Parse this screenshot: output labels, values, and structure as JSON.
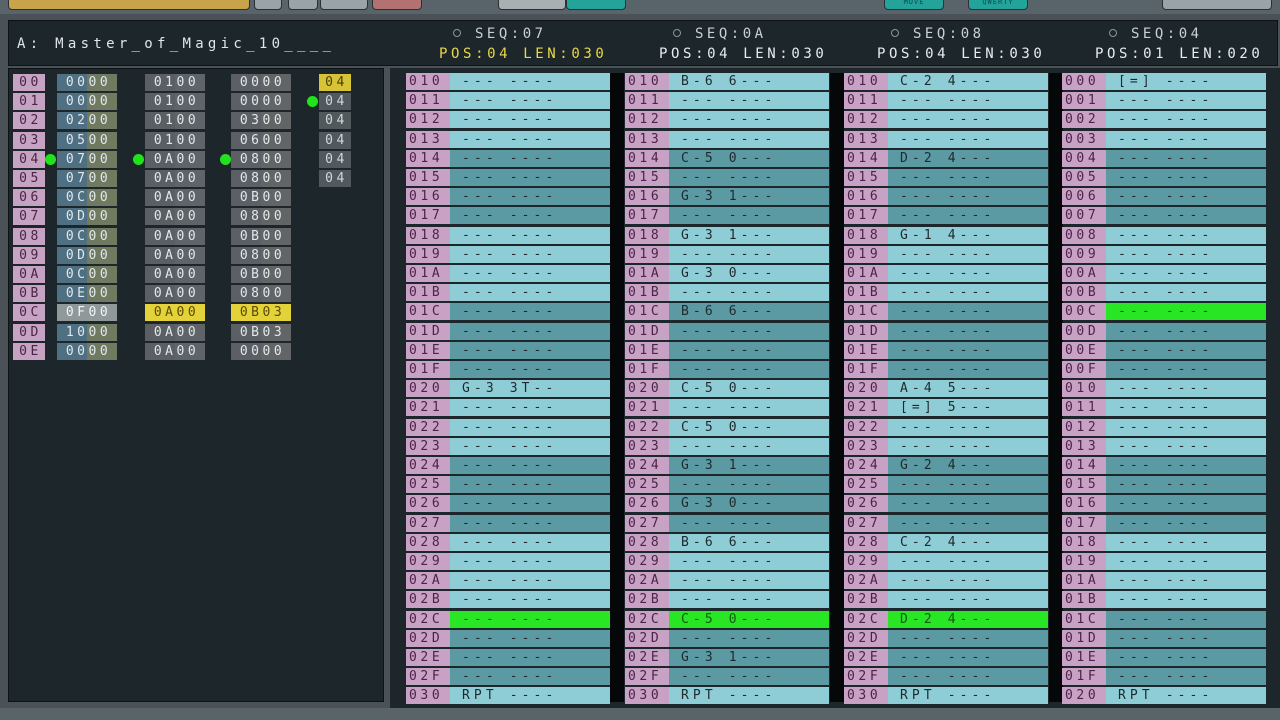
{
  "toolbar": {
    "buttons": [
      {
        "label": "",
        "color": "#c7a34a"
      },
      {
        "label": "",
        "color": "#9aa3a8"
      },
      {
        "label": "",
        "color": "#9aa3a8"
      },
      {
        "label": "",
        "color": "#9aa3a8"
      },
      {
        "label": "",
        "color": "#b27272"
      },
      {
        "label": "",
        "color": "#a8b0b4"
      },
      {
        "label": "",
        "color": "#24a39b"
      },
      {
        "label": "MOVE",
        "color": "#24a39b"
      },
      {
        "label": "QWERTY",
        "color": "#24a39b"
      },
      {
        "label": "",
        "color": "#9aa3a8"
      }
    ]
  },
  "header": {
    "title": "A: Master_of_Magic_10____",
    "sequences": [
      {
        "seq": "SEQ:07",
        "pos": "POS:04",
        "len": "LEN:030",
        "current": true
      },
      {
        "seq": "SEQ:0A",
        "pos": "POS:04",
        "len": "LEN:030",
        "current": false
      },
      {
        "seq": "SEQ:08",
        "pos": "POS:04",
        "len": "LEN:030",
        "current": false
      },
      {
        "seq": "SEQ:04",
        "pos": "POS:01",
        "len": "LEN:020",
        "current": false
      }
    ]
  },
  "orderlist": {
    "rows": [
      {
        "idx": "00",
        "t1": "0000",
        "t2": "0100",
        "t3": "0000",
        "t4": "04"
      },
      {
        "idx": "01",
        "t1": "0000",
        "t2": "0100",
        "t3": "0000",
        "t4": "04"
      },
      {
        "idx": "02",
        "t1": "0200",
        "t2": "0100",
        "t3": "0300",
        "t4": "04"
      },
      {
        "idx": "03",
        "t1": "0500",
        "t2": "0100",
        "t3": "0600",
        "t4": "04"
      },
      {
        "idx": "04",
        "t1": "0700",
        "t2": "0A00",
        "t3": "0800",
        "t4": "04"
      },
      {
        "idx": "05",
        "t1": "0700",
        "t2": "0A00",
        "t3": "0800",
        "t4": "04"
      },
      {
        "idx": "06",
        "t1": "0C00",
        "t2": "0A00",
        "t3": "0B00",
        "t4": ""
      },
      {
        "idx": "07",
        "t1": "0D00",
        "t2": "0A00",
        "t3": "0800",
        "t4": ""
      },
      {
        "idx": "08",
        "t1": "0C00",
        "t2": "0A00",
        "t3": "0B00",
        "t4": ""
      },
      {
        "idx": "09",
        "t1": "0D00",
        "t2": "0A00",
        "t3": "0800",
        "t4": ""
      },
      {
        "idx": "0A",
        "t1": "0C00",
        "t2": "0A00",
        "t3": "0B00",
        "t4": ""
      },
      {
        "idx": "0B",
        "t1": "0E00",
        "t2": "0A00",
        "t3": "0800",
        "t4": ""
      },
      {
        "idx": "0C",
        "t1": "0F00",
        "t2": "0A00",
        "t3": "0B03",
        "t4": ""
      },
      {
        "idx": "0D",
        "t1": "1000",
        "t2": "0A00",
        "t3": "0B03",
        "t4": ""
      },
      {
        "idx": "0E",
        "t1": "0000",
        "t2": "0A00",
        "t3": "0000",
        "t4": ""
      }
    ]
  },
  "pattern": {
    "columns": [
      {
        "rows": [
          [
            "010",
            "--- ----"
          ],
          [
            "011",
            "--- ----"
          ],
          [
            "012",
            "--- ----"
          ],
          [
            "013",
            "--- ----"
          ],
          [
            "014",
            "--- ----"
          ],
          [
            "015",
            "--- ----"
          ],
          [
            "016",
            "--- ----"
          ],
          [
            "017",
            "--- ----"
          ],
          [
            "018",
            "--- ----"
          ],
          [
            "019",
            "--- ----"
          ],
          [
            "01A",
            "--- ----"
          ],
          [
            "01B",
            "--- ----"
          ],
          [
            "01C",
            "--- ----"
          ],
          [
            "01D",
            "--- ----"
          ],
          [
            "01E",
            "--- ----"
          ],
          [
            "01F",
            "--- ----"
          ],
          [
            "020",
            "G-3 3T--"
          ],
          [
            "021",
            "--- ----"
          ],
          [
            "022",
            "--- ----"
          ],
          [
            "023",
            "--- ----"
          ],
          [
            "024",
            "--- ----"
          ],
          [
            "025",
            "--- ----"
          ],
          [
            "026",
            "--- ----"
          ],
          [
            "027",
            "--- ----"
          ],
          [
            "028",
            "--- ----"
          ],
          [
            "029",
            "--- ----"
          ],
          [
            "02A",
            "--- ----"
          ],
          [
            "02B",
            "--- ----"
          ],
          [
            "02C",
            "--- ----"
          ],
          [
            "02D",
            "--- ----"
          ],
          [
            "02E",
            "--- ----"
          ],
          [
            "02F",
            "--- ----"
          ],
          [
            "030",
            "RPT ----"
          ]
        ]
      },
      {
        "rows": [
          [
            "010",
            "B-6 6---"
          ],
          [
            "011",
            "--- ----"
          ],
          [
            "012",
            "--- ----"
          ],
          [
            "013",
            "--- ----"
          ],
          [
            "014",
            "C-5 0---"
          ],
          [
            "015",
            "--- ----"
          ],
          [
            "016",
            "G-3 1---"
          ],
          [
            "017",
            "--- ----"
          ],
          [
            "018",
            "G-3 1---"
          ],
          [
            "019",
            "--- ----"
          ],
          [
            "01A",
            "G-3 0---"
          ],
          [
            "01B",
            "--- ----"
          ],
          [
            "01C",
            "B-6 6---"
          ],
          [
            "01D",
            "--- ----"
          ],
          [
            "01E",
            "--- ----"
          ],
          [
            "01F",
            "--- ----"
          ],
          [
            "020",
            "C-5 0---"
          ],
          [
            "021",
            "--- ----"
          ],
          [
            "022",
            "C-5 0---"
          ],
          [
            "023",
            "--- ----"
          ],
          [
            "024",
            "G-3 1---"
          ],
          [
            "025",
            "--- ----"
          ],
          [
            "026",
            "G-3 0---"
          ],
          [
            "027",
            "--- ----"
          ],
          [
            "028",
            "B-6 6---"
          ],
          [
            "029",
            "--- ----"
          ],
          [
            "02A",
            "--- ----"
          ],
          [
            "02B",
            "--- ----"
          ],
          [
            "02C",
            "C-5 0---"
          ],
          [
            "02D",
            "--- ----"
          ],
          [
            "02E",
            "G-3 1---"
          ],
          [
            "02F",
            "--- ----"
          ],
          [
            "030",
            "RPT ----"
          ]
        ]
      },
      {
        "rows": [
          [
            "010",
            "C-2 4---"
          ],
          [
            "011",
            "--- ----"
          ],
          [
            "012",
            "--- ----"
          ],
          [
            "013",
            "--- ----"
          ],
          [
            "014",
            "D-2 4---"
          ],
          [
            "015",
            "--- ----"
          ],
          [
            "016",
            "--- ----"
          ],
          [
            "017",
            "--- ----"
          ],
          [
            "018",
            "G-1 4---"
          ],
          [
            "019",
            "--- ----"
          ],
          [
            "01A",
            "--- ----"
          ],
          [
            "01B",
            "--- ----"
          ],
          [
            "01C",
            "--- ----"
          ],
          [
            "01D",
            "--- ----"
          ],
          [
            "01E",
            "--- ----"
          ],
          [
            "01F",
            "--- ----"
          ],
          [
            "020",
            "A-4 5---"
          ],
          [
            "021",
            "[=] 5---"
          ],
          [
            "022",
            "--- ----"
          ],
          [
            "023",
            "--- ----"
          ],
          [
            "024",
            "G-2 4---"
          ],
          [
            "025",
            "--- ----"
          ],
          [
            "026",
            "--- ----"
          ],
          [
            "027",
            "--- ----"
          ],
          [
            "028",
            "C-2 4---"
          ],
          [
            "029",
            "--- ----"
          ],
          [
            "02A",
            "--- ----"
          ],
          [
            "02B",
            "--- ----"
          ],
          [
            "02C",
            "D-2 4---"
          ],
          [
            "02D",
            "--- ----"
          ],
          [
            "02E",
            "--- ----"
          ],
          [
            "02F",
            "--- ----"
          ],
          [
            "030",
            "RPT ----"
          ]
        ]
      },
      {
        "rows": [
          [
            "000",
            "[=] ----"
          ],
          [
            "001",
            "--- ----"
          ],
          [
            "002",
            "--- ----"
          ],
          [
            "003",
            "--- ----"
          ],
          [
            "004",
            "--- ----"
          ],
          [
            "005",
            "--- ----"
          ],
          [
            "006",
            "--- ----"
          ],
          [
            "007",
            "--- ----"
          ],
          [
            "008",
            "--- ----"
          ],
          [
            "009",
            "--- ----"
          ],
          [
            "00A",
            "--- ----"
          ],
          [
            "00B",
            "--- ----"
          ],
          [
            "00C",
            "--- ----"
          ],
          [
            "00D",
            "--- ----"
          ],
          [
            "00E",
            "--- ----"
          ],
          [
            "00F",
            "--- ----"
          ],
          [
            "010",
            "--- ----"
          ],
          [
            "011",
            "--- ----"
          ],
          [
            "012",
            "--- ----"
          ],
          [
            "013",
            "--- ----"
          ],
          [
            "014",
            "--- ----"
          ],
          [
            "015",
            "--- ----"
          ],
          [
            "016",
            "--- ----"
          ],
          [
            "017",
            "--- ----"
          ],
          [
            "018",
            "--- ----"
          ],
          [
            "019",
            "--- ----"
          ],
          [
            "01A",
            "--- ----"
          ],
          [
            "01B",
            "--- ----"
          ],
          [
            "01C",
            "--- ----"
          ],
          [
            "01D",
            "--- ----"
          ],
          [
            "01E",
            "--- ----"
          ],
          [
            "01F",
            "--- ----"
          ],
          [
            "020",
            "RPT ----"
          ]
        ]
      }
    ]
  }
}
